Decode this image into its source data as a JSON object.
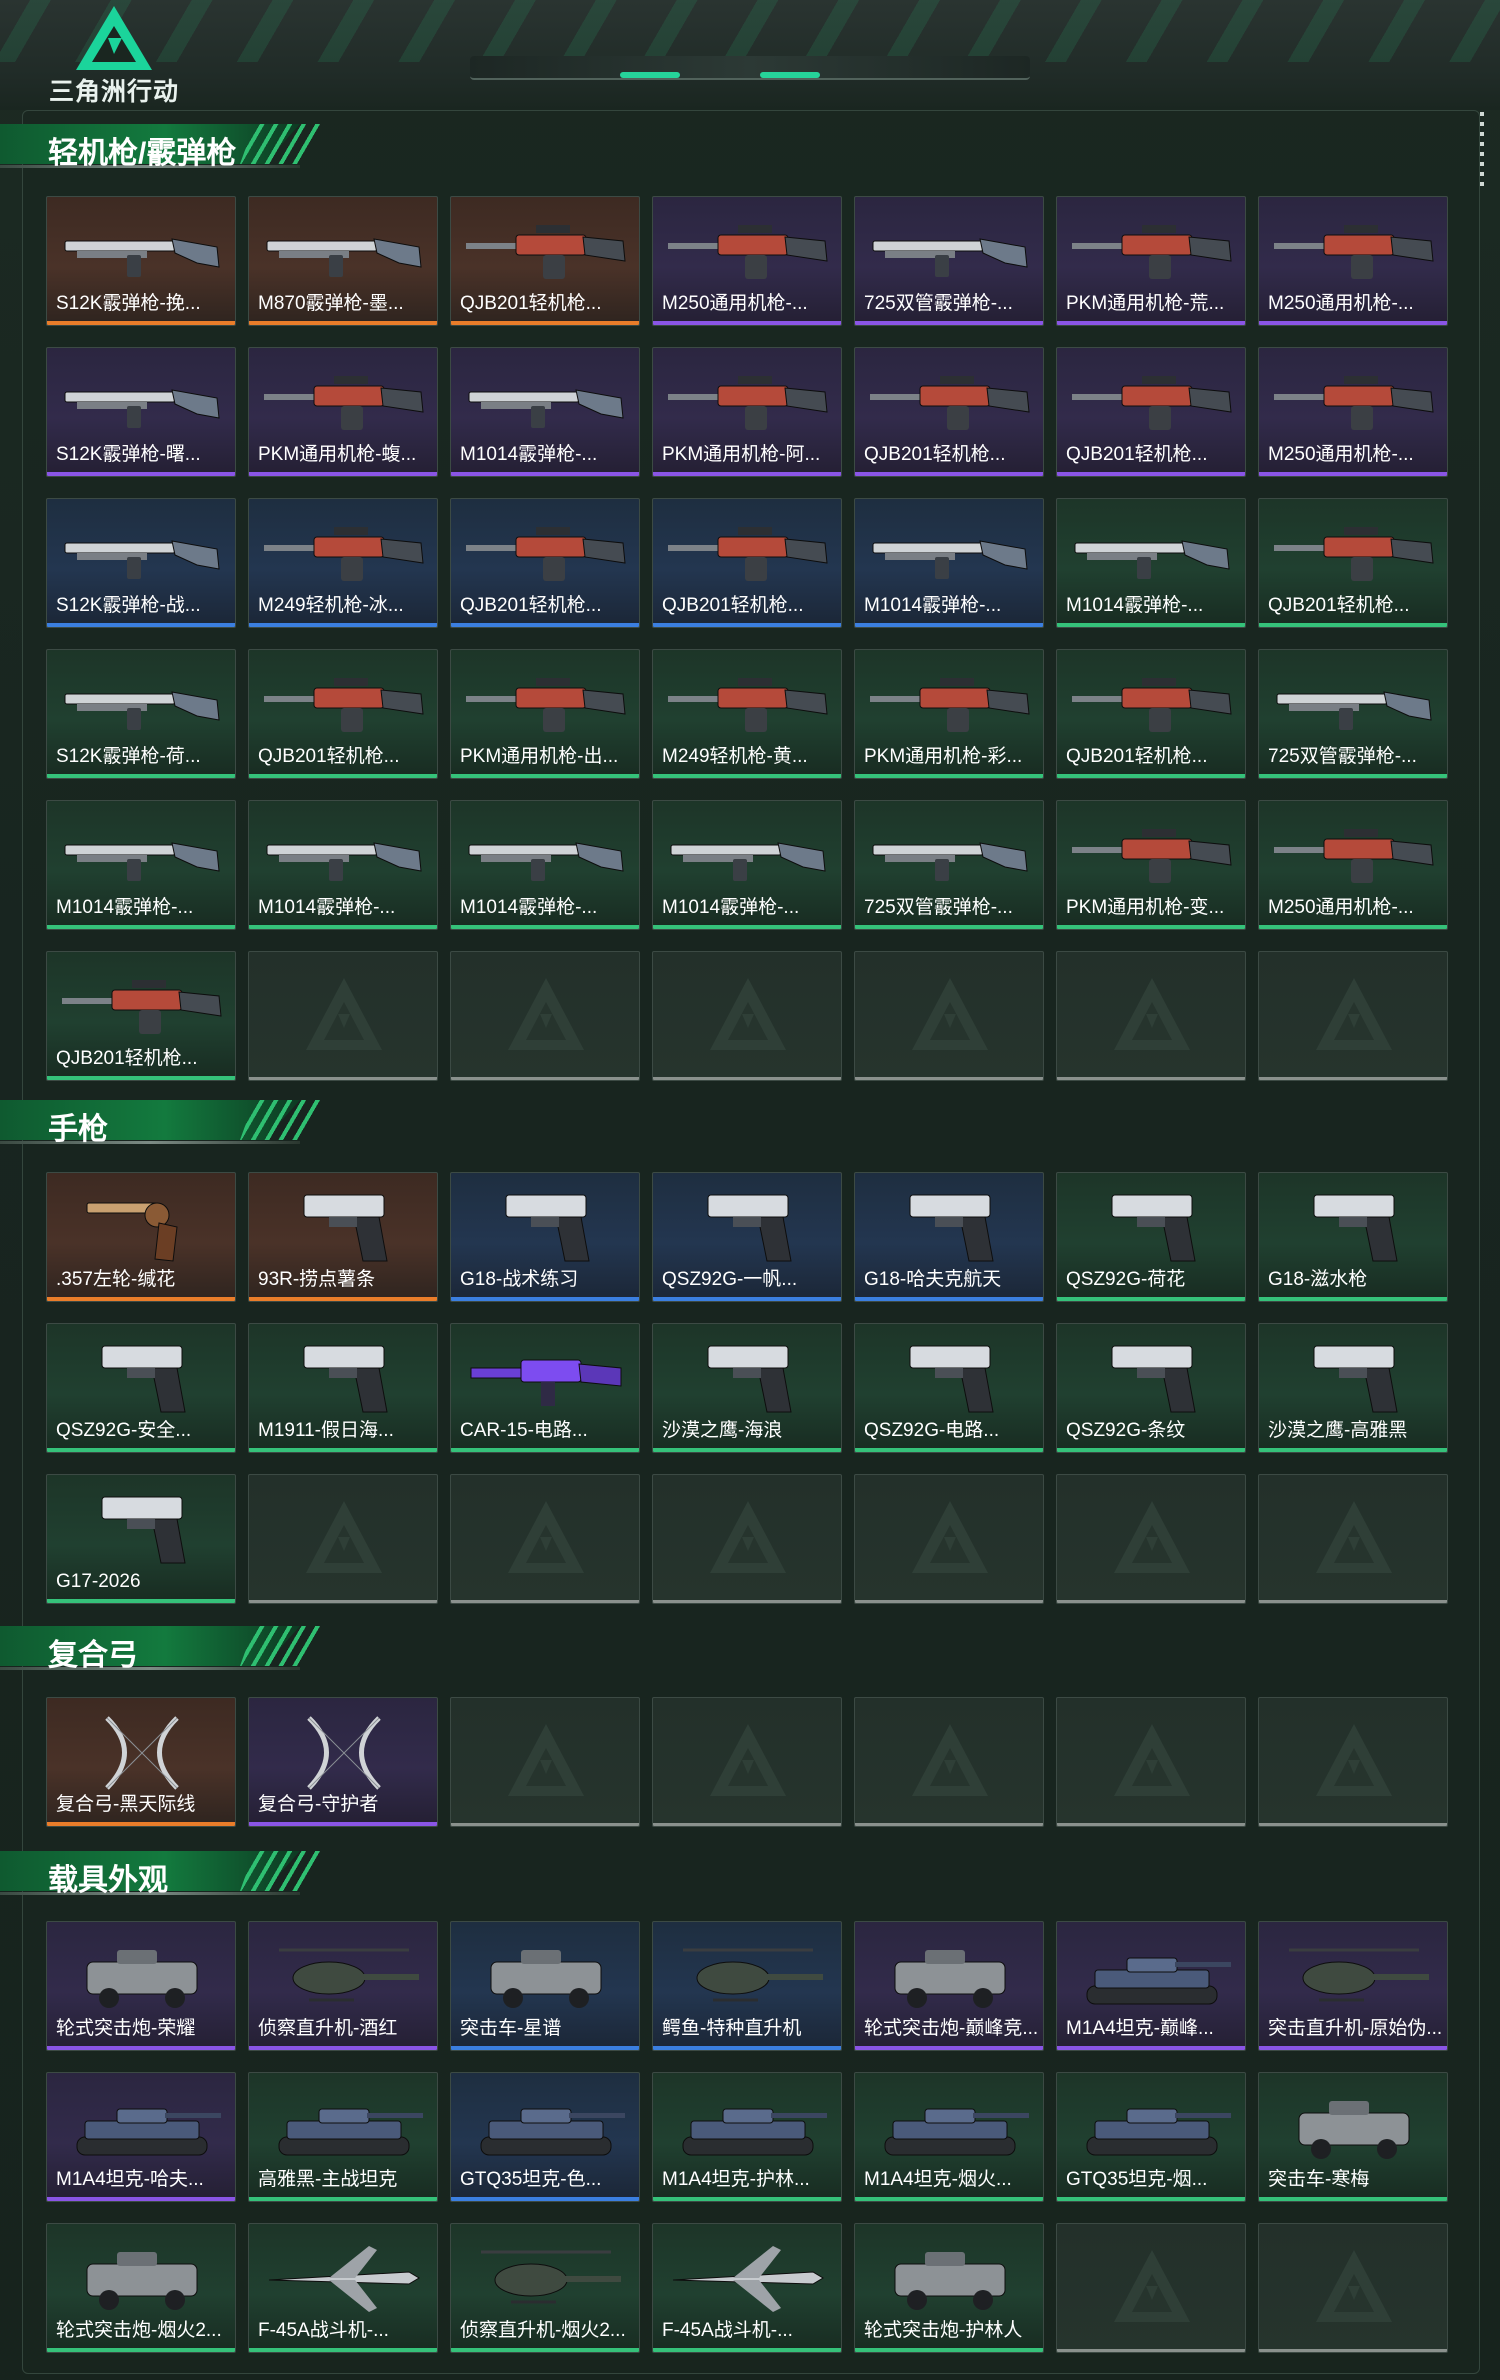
{
  "app": {
    "logo_text": "三角洲行动"
  },
  "sections": [
    {
      "title": "轻机枪/霰弹枪",
      "top": 0,
      "items": [
        {
          "label": "S12K霰弹枪-挽...",
          "rarity": "orange",
          "icon": "shotgun-icon"
        },
        {
          "label": "M870霰弹枪-墨...",
          "rarity": "orange",
          "icon": "shotgun-icon"
        },
        {
          "label": "QJB201轻机枪...",
          "rarity": "orange",
          "icon": "lmg-icon"
        },
        {
          "label": "M250通用机枪-...",
          "rarity": "purple",
          "icon": "lmg-icon"
        },
        {
          "label": "725双管霰弹枪-...",
          "rarity": "purple",
          "icon": "shotgun-icon"
        },
        {
          "label": "PKM通用机枪-荒...",
          "rarity": "purple",
          "icon": "lmg-icon"
        },
        {
          "label": "M250通用机枪-...",
          "rarity": "purple",
          "icon": "lmg-icon"
        },
        {
          "label": "S12K霰弹枪-曙...",
          "rarity": "purple",
          "icon": "shotgun-icon"
        },
        {
          "label": "PKM通用机枪-蝮...",
          "rarity": "purple",
          "icon": "lmg-icon"
        },
        {
          "label": "M1014霰弹枪-...",
          "rarity": "purple",
          "icon": "shotgun-icon"
        },
        {
          "label": "PKM通用机枪-阿...",
          "rarity": "purple",
          "icon": "lmg-icon"
        },
        {
          "label": "QJB201轻机枪...",
          "rarity": "purple",
          "icon": "lmg-icon"
        },
        {
          "label": "QJB201轻机枪...",
          "rarity": "purple",
          "icon": "lmg-icon"
        },
        {
          "label": "M250通用机枪-...",
          "rarity": "purple",
          "icon": "lmg-icon"
        },
        {
          "label": "S12K霰弹枪-战...",
          "rarity": "blue",
          "icon": "shotgun-icon"
        },
        {
          "label": "M249轻机枪-冰...",
          "rarity": "blue",
          "icon": "lmg-icon"
        },
        {
          "label": "QJB201轻机枪...",
          "rarity": "blue",
          "icon": "lmg-icon"
        },
        {
          "label": "QJB201轻机枪...",
          "rarity": "blue",
          "icon": "lmg-icon"
        },
        {
          "label": "M1014霰弹枪-...",
          "rarity": "blue",
          "icon": "shotgun-icon"
        },
        {
          "label": "M1014霰弹枪-...",
          "rarity": "green",
          "icon": "shotgun-icon"
        },
        {
          "label": "QJB201轻机枪...",
          "rarity": "green",
          "icon": "lmg-icon"
        },
        {
          "label": "S12K霰弹枪-荷...",
          "rarity": "green",
          "icon": "shotgun-icon"
        },
        {
          "label": "QJB201轻机枪...",
          "rarity": "green",
          "icon": "lmg-icon"
        },
        {
          "label": "PKM通用机枪-出...",
          "rarity": "green",
          "icon": "lmg-icon"
        },
        {
          "label": "M249轻机枪-黄...",
          "rarity": "green",
          "icon": "lmg-icon"
        },
        {
          "label": "PKM通用机枪-彩...",
          "rarity": "green",
          "icon": "lmg-icon"
        },
        {
          "label": "QJB201轻机枪...",
          "rarity": "green",
          "icon": "lmg-icon"
        },
        {
          "label": "725双管霰弹枪-...",
          "rarity": "green",
          "icon": "shotgun-icon"
        },
        {
          "label": "M1014霰弹枪-...",
          "rarity": "green",
          "icon": "shotgun-icon"
        },
        {
          "label": "M1014霰弹枪-...",
          "rarity": "green",
          "icon": "shotgun-icon"
        },
        {
          "label": "M1014霰弹枪-...",
          "rarity": "green",
          "icon": "shotgun-icon"
        },
        {
          "label": "M1014霰弹枪-...",
          "rarity": "green",
          "icon": "shotgun-icon"
        },
        {
          "label": "725双管霰弹枪-...",
          "rarity": "green",
          "icon": "shotgun-icon"
        },
        {
          "label": "PKM通用机枪-变...",
          "rarity": "green",
          "icon": "lmg-icon"
        },
        {
          "label": "M250通用机枪-...",
          "rarity": "green",
          "icon": "lmg-icon"
        },
        {
          "label": "QJB201轻机枪...",
          "rarity": "green",
          "icon": "lmg-icon"
        }
      ],
      "empty_slots": 6
    },
    {
      "title": "手枪",
      "items": [
        {
          "label": ".357左轮-缄花",
          "rarity": "orange",
          "icon": "revolver-icon"
        },
        {
          "label": "93R-捞点薯条",
          "rarity": "orange",
          "icon": "pistol-icon"
        },
        {
          "label": "G18-战术练习",
          "rarity": "blue",
          "icon": "pistol-icon"
        },
        {
          "label": "QSZ92G-一帆...",
          "rarity": "blue",
          "icon": "pistol-icon"
        },
        {
          "label": "G18-哈夫克航天",
          "rarity": "blue",
          "icon": "pistol-icon"
        },
        {
          "label": "QSZ92G-荷花",
          "rarity": "green",
          "icon": "pistol-icon"
        },
        {
          "label": "G18-滋水枪",
          "rarity": "green",
          "icon": "pistol-icon"
        },
        {
          "label": "QSZ92G-安全...",
          "rarity": "green",
          "icon": "pistol-icon"
        },
        {
          "label": "M1911-假日海...",
          "rarity": "green",
          "icon": "pistol-icon"
        },
        {
          "label": "CAR-15-电路...",
          "rarity": "green",
          "icon": "rifle-icon"
        },
        {
          "label": "沙漠之鹰-海浪",
          "rarity": "green",
          "icon": "pistol-icon"
        },
        {
          "label": "QSZ92G-电路...",
          "rarity": "green",
          "icon": "pistol-icon"
        },
        {
          "label": "QSZ92G-条纹",
          "rarity": "green",
          "icon": "pistol-icon"
        },
        {
          "label": "沙漠之鹰-高雅黑",
          "rarity": "green",
          "icon": "pistol-icon"
        },
        {
          "label": "G17-2026",
          "rarity": "green",
          "icon": "pistol-icon"
        }
      ],
      "empty_slots": 6
    },
    {
      "title": "复合弓",
      "items": [
        {
          "label": "复合弓-黑天际线",
          "rarity": "orange",
          "icon": "bow-icon"
        },
        {
          "label": "复合弓-守护者",
          "rarity": "purple",
          "icon": "bow-icon"
        }
      ],
      "empty_slots": 5
    },
    {
      "title": "载具外观",
      "items": [
        {
          "label": "轮式突击炮-荣耀",
          "rarity": "purple",
          "icon": "armored-car-icon"
        },
        {
          "label": "侦察直升机-酒红",
          "rarity": "purple",
          "icon": "helicopter-icon"
        },
        {
          "label": "突击车-星谱",
          "rarity": "blue",
          "icon": "armored-car-icon"
        },
        {
          "label": "鳄鱼-特种直升机",
          "rarity": "blue",
          "icon": "helicopter-icon"
        },
        {
          "label": "轮式突击炮-巅峰竞...",
          "rarity": "purple",
          "icon": "armored-car-icon"
        },
        {
          "label": "M1A4坦克-巅峰...",
          "rarity": "purple",
          "icon": "tank-icon"
        },
        {
          "label": "突击直升机-原始伪...",
          "rarity": "purple",
          "icon": "helicopter-icon"
        },
        {
          "label": "M1A4坦克-哈夫...",
          "rarity": "purple",
          "icon": "tank-icon"
        },
        {
          "label": "高雅黑-主战坦克",
          "rarity": "green",
          "icon": "tank-icon"
        },
        {
          "label": "GTQ35坦克-色...",
          "rarity": "blue",
          "icon": "tank-icon"
        },
        {
          "label": "M1A4坦克-护林...",
          "rarity": "green",
          "icon": "tank-icon"
        },
        {
          "label": "M1A4坦克-烟火...",
          "rarity": "green",
          "icon": "tank-icon"
        },
        {
          "label": "GTQ35坦克-烟...",
          "rarity": "green",
          "icon": "tank-icon"
        },
        {
          "label": "突击车-寒梅",
          "rarity": "green",
          "icon": "armored-car-icon"
        },
        {
          "label": "轮式突击炮-烟火2...",
          "rarity": "green",
          "icon": "armored-car-icon"
        },
        {
          "label": "F-45A战斗机-...",
          "rarity": "green",
          "icon": "jet-icon"
        },
        {
          "label": "侦察直升机-烟火2...",
          "rarity": "green",
          "icon": "helicopter-icon"
        },
        {
          "label": "F-45A战斗机-...",
          "rarity": "green",
          "icon": "jet-icon"
        },
        {
          "label": "轮式突击炮-护林人",
          "rarity": "green",
          "icon": "armored-car-icon"
        }
      ],
      "empty_slots": 2
    }
  ],
  "colors": {
    "rarity_orange": "#e97d2a",
    "rarity_purple": "#8a55e6",
    "rarity_blue": "#3b7fe0",
    "rarity_green": "#35c27a",
    "accent": "#26d39a"
  }
}
